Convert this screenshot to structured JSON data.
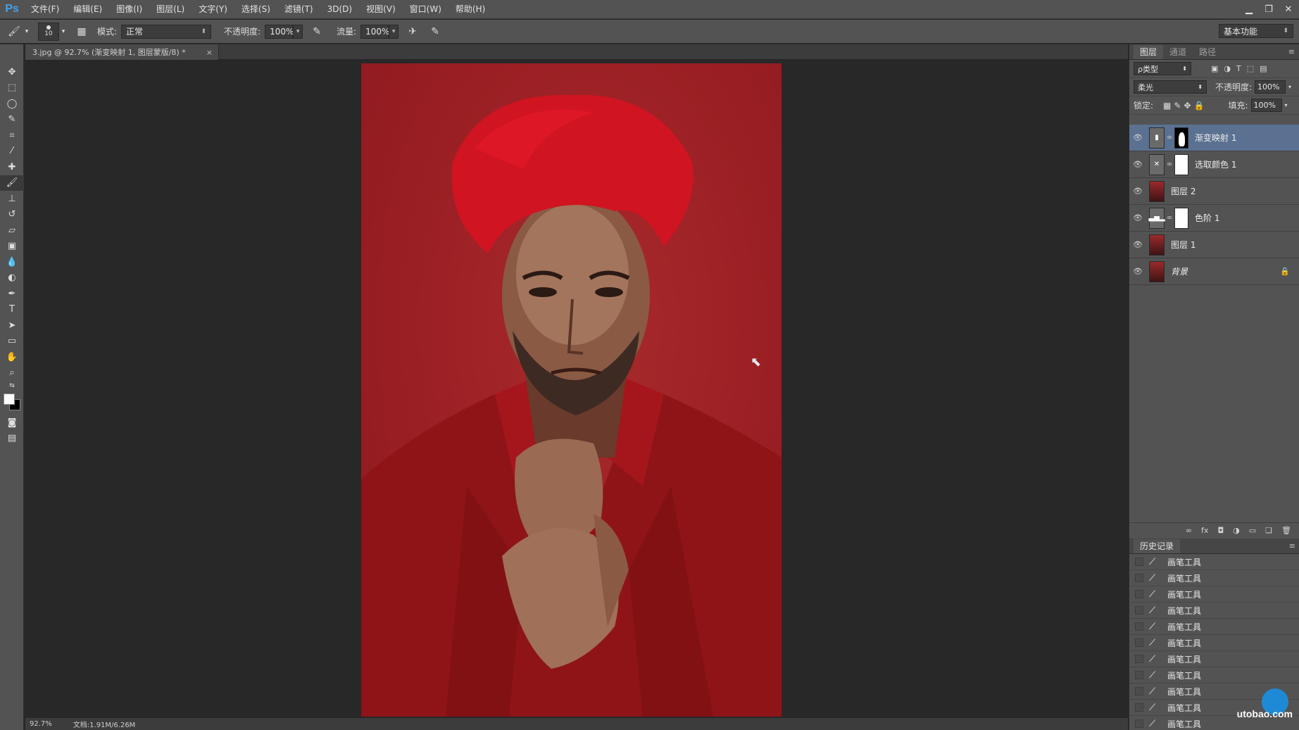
{
  "app": {
    "logo": "Ps"
  },
  "menu": [
    "文件(F)",
    "编辑(E)",
    "图像(I)",
    "图层(L)",
    "文字(Y)",
    "选择(S)",
    "滤镜(T)",
    "3D(D)",
    "视图(V)",
    "窗口(W)",
    "帮助(H)"
  ],
  "options": {
    "brush_size": "10",
    "mode_label": "模式:",
    "mode_value": "正常",
    "opacity_label": "不透明度:",
    "opacity_value": "100%",
    "flow_label": "流量:",
    "flow_value": "100%",
    "workspace": "基本功能"
  },
  "document": {
    "tab_title": "3.jpg @ 92.7% (渐变映射 1, 图层蒙版/8) *",
    "tab_close": "×",
    "zoom": "92.7%",
    "doc_info": "文档:1.91M/6.26M"
  },
  "layers_panel": {
    "tabs": [
      "图层",
      "通道",
      "路径"
    ],
    "filter_select": "ρ类型",
    "blend_mode": "柔光",
    "opacity_label": "不透明度:",
    "opacity_value": "100%",
    "lock_label": "锁定:",
    "fill_label": "填充:",
    "fill_value": "100%",
    "layers": [
      {
        "name": "渐变映射 1",
        "selected": true
      },
      {
        "name": "选取颜色 1",
        "selected": false
      },
      {
        "name": "图层 2",
        "selected": false
      },
      {
        "name": "色阶 1",
        "selected": false
      },
      {
        "name": "图层 1",
        "selected": false
      },
      {
        "name": "背景",
        "selected": false
      }
    ]
  },
  "history_panel": {
    "title": "历史记录",
    "items": [
      "画笔工具",
      "画笔工具",
      "画笔工具",
      "画笔工具",
      "画笔工具",
      "画笔工具",
      "画笔工具",
      "画笔工具",
      "画笔工具",
      "画笔工具",
      "画笔工具",
      "画笔工具",
      "画笔工具"
    ]
  },
  "watermark": {
    "text": "utobao.com"
  },
  "colors": {
    "accent": "#5a7191",
    "photo_red": "#9a1f24",
    "logo_blue": "#3fa3f0"
  }
}
